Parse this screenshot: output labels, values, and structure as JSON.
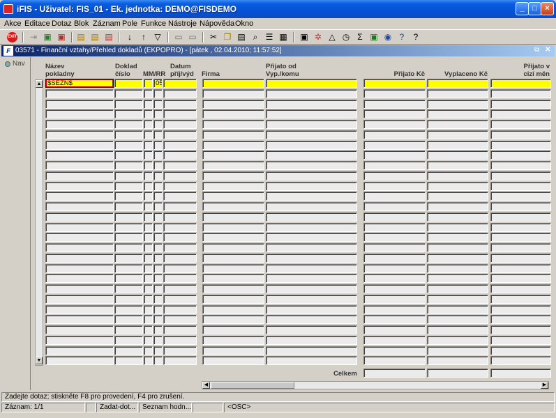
{
  "window": {
    "title": "iFIS - Uživatel: FIS_01 - Ek. jednotka: DEMO@FISDEMO"
  },
  "menu": [
    "Akce",
    "Editace",
    "Dotaz",
    "Blok",
    "Záznam",
    "Pole",
    "Funkce",
    "Nástroje",
    "Nápověda",
    "Okno"
  ],
  "toolbar": {
    "exit_label": "EXIT"
  },
  "form_title": "03571 - Finanční vztahy/Přehled dokladů (EKPOPRO) - [pátek , 02.04.2010; 11:57:52]",
  "nav_label": "Nav",
  "columns": {
    "nazev_pokladny": "Název\npokladny",
    "doklad_cislo": "Doklad\nčíslo",
    "mm_rr": "MM/RR",
    "datum": "Datum\npříj/výd",
    "firma": "Firma",
    "prijato_od": "Přijato od\nVyp./komu",
    "prijato_kc": "Přijato Kč",
    "vyplaceno_kc": "Vyplaceno Kč",
    "prijato_cizi": "Přijato v\ncizí měn"
  },
  "first_row": {
    "nazev_pokladny": "$SEZN$",
    "mm_rr": "05"
  },
  "total_label": "Celkem",
  "status_message": "Zadejte dotaz; stiskněte F8 pro provedení, F4 pro zrušení.",
  "statusbar": {
    "record": "Záznam: 1/1",
    "mode": "Zadat-dot...",
    "list": "Seznam hodn...",
    "osc": "<OSC>"
  },
  "colors": {
    "query_field": "#ffff00",
    "title_bar": "#0a5ee0"
  },
  "visible_rows": 28
}
